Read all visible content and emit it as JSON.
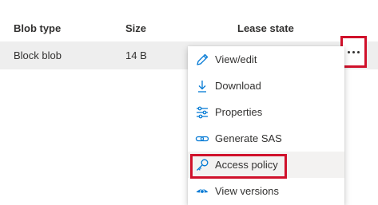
{
  "table": {
    "headers": [
      "Blob type",
      "Size",
      "Lease state"
    ],
    "rows": [
      {
        "blob_type": "Block blob",
        "size": "14 B",
        "lease_state": ""
      }
    ]
  },
  "more_button": {
    "icon": "more-horizontal-icon"
  },
  "context_menu": {
    "items": [
      {
        "label": "View/edit",
        "icon": "pencil-icon"
      },
      {
        "label": "Download",
        "icon": "download-icon"
      },
      {
        "label": "Properties",
        "icon": "sliders-icon"
      },
      {
        "label": "Generate SAS",
        "icon": "link-icon"
      },
      {
        "label": "Access policy",
        "icon": "key-icon"
      },
      {
        "label": "View versions",
        "icon": "eye-icon"
      }
    ]
  },
  "colors": {
    "accent": "#0078d4",
    "highlight_border": "#d0112b",
    "row_selected": "#eeeeee",
    "menu_hover": "#f3f2f1"
  }
}
